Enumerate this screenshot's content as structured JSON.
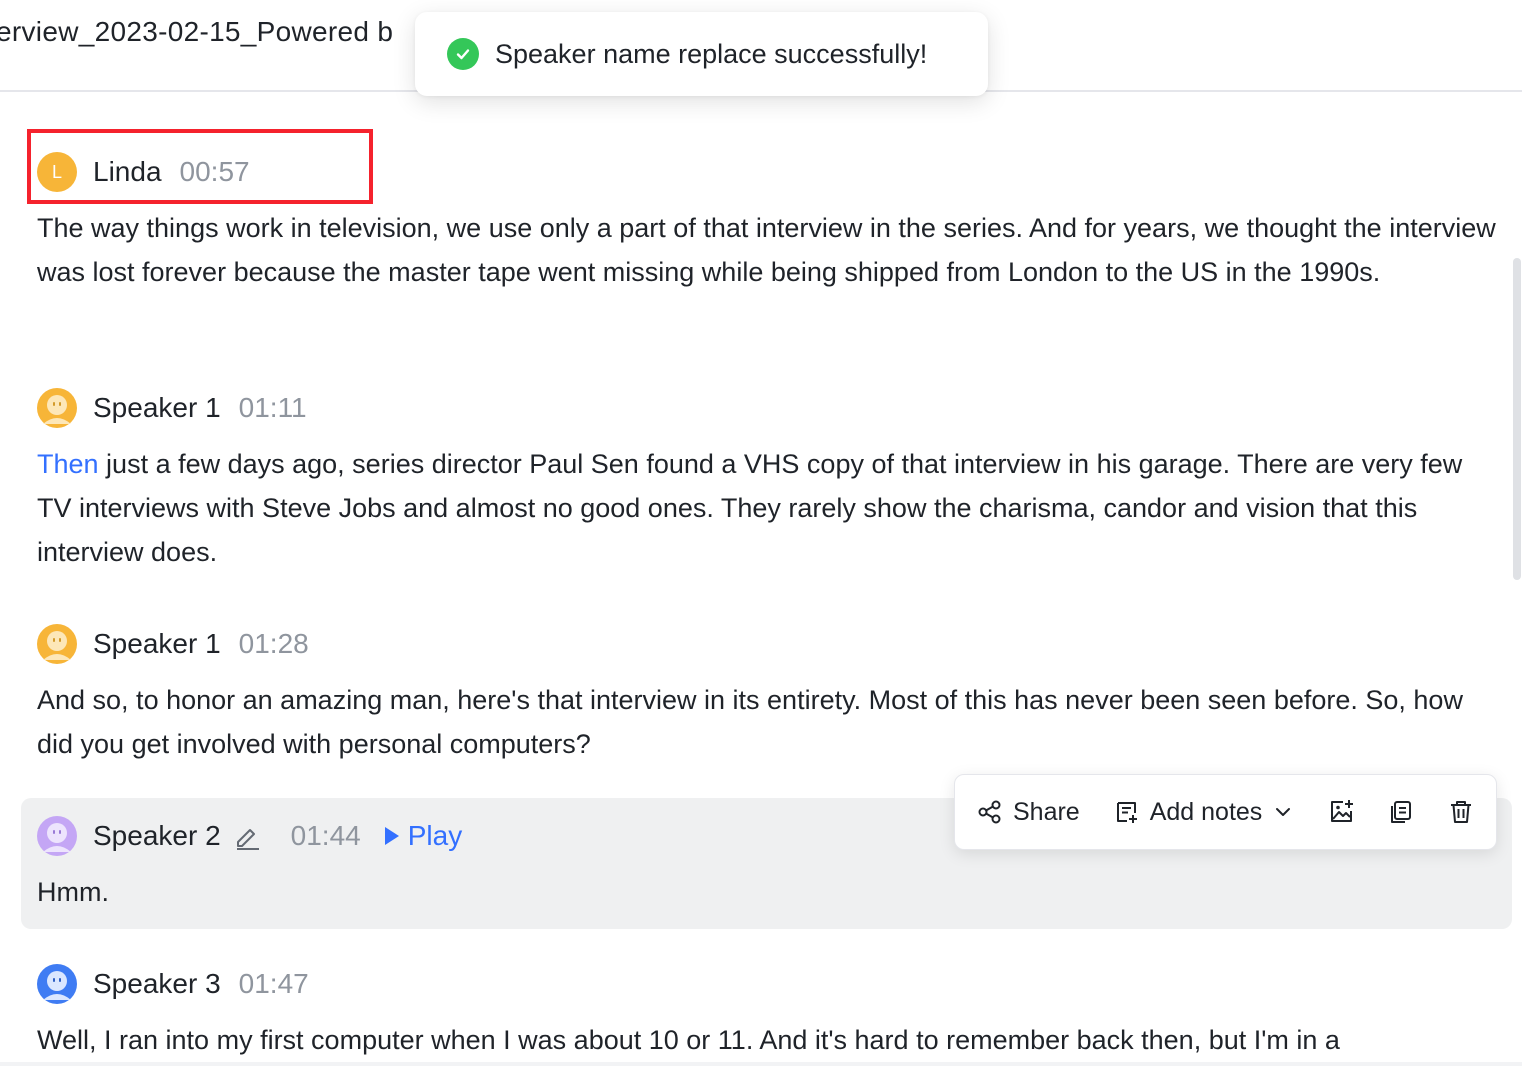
{
  "header": {
    "doc_title": "erview_2023-02-15_Powered b",
    "partial_text": "~~ ~~ · ~"
  },
  "toast": {
    "icon": "check-circle-icon",
    "message": "Speaker name replace successfully!",
    "color": "#34c759"
  },
  "segments": [
    {
      "avatar_letter": "L",
      "avatar_color": "#f7b538",
      "speaker": "Linda",
      "time": "00:57",
      "text": "The way things work in television, we use only a part of that interview in the series. And for years, we thought the interview was lost forever because the master tape went missing while being shipped from London to the US in the 1990s."
    },
    {
      "avatar_color": "#f7b538",
      "speaker": "Speaker 1",
      "time": "01:11",
      "text_highlight": "Then",
      "text": " just a few days ago, series director Paul Sen found a VHS copy of that interview in his garage. There are very few TV interviews with Steve Jobs and almost no good ones. They rarely show the charisma, candor and vision that this interview does."
    },
    {
      "avatar_color": "#f7b538",
      "speaker": "Speaker 1",
      "time": "01:28",
      "text": "And so, to honor an amazing man, here's that interview in its entirety. Most of this has never been seen before. So, how did you get involved with personal computers?"
    },
    {
      "avatar_color": "#c4a6f5",
      "speaker": "Speaker 2",
      "time": "01:44",
      "play_label": "Play",
      "text": "Hmm."
    },
    {
      "avatar_color": "#3f7cf3",
      "speaker": "Speaker 3",
      "time": "01:47",
      "text": "Well, I ran into my first computer when I was about 10 or 11. And it's hard to remember back then, but I'm in a"
    }
  ],
  "toolbar": {
    "share_label": "Share",
    "add_notes_label": "Add notes",
    "icons": [
      "share-icon",
      "notes-icon",
      "chevron-down-icon",
      "image-add-icon",
      "copy-icon",
      "delete-icon"
    ]
  },
  "accent_color": "#3370ff"
}
